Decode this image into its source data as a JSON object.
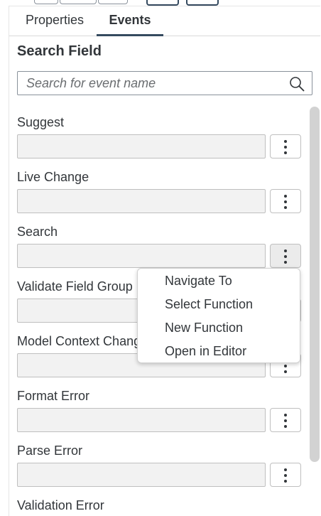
{
  "tabs": [
    {
      "label": "Properties"
    },
    {
      "label": "Events",
      "active": true
    }
  ],
  "section_title": "Search Field",
  "search": {
    "placeholder": "Search for event name",
    "value": ""
  },
  "events": [
    {
      "label": "Suggest"
    },
    {
      "label": "Live Change"
    },
    {
      "label": "Search"
    },
    {
      "label": "Validate Field Group"
    },
    {
      "label": "Model Context Change"
    },
    {
      "label": "Format Error"
    },
    {
      "label": "Parse Error"
    },
    {
      "label": "Validation Error"
    }
  ],
  "context_menu": {
    "items": [
      {
        "label": "Navigate To"
      },
      {
        "label": "Select Function"
      },
      {
        "label": "New Function"
      },
      {
        "label": "Open in Editor"
      }
    ]
  },
  "colors": {
    "accent": "#354a5f",
    "text": "#32363a",
    "field_bg": "#f2f2f2",
    "border": "#bfbfbf"
  }
}
